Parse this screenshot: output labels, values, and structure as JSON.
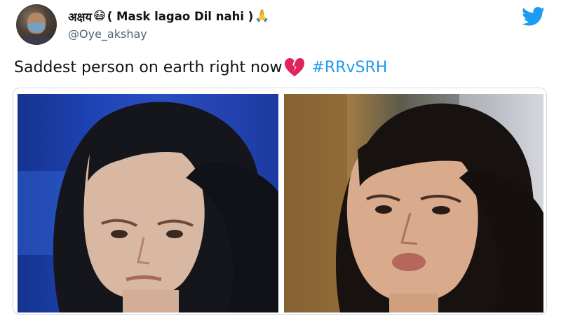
{
  "tweet": {
    "display_name_prefix": "अक्षय",
    "display_name_emoji_1": "😷",
    "display_name_main": "( Mask lagao Dil nahi )",
    "display_name_emoji_2": "🙏",
    "handle": "@Oye_akshay",
    "text": "Saddest person on earth right now",
    "text_emoji": "broken-heart",
    "hashtag": "#RRvSRH"
  },
  "icons": {
    "logo": "twitter-bird-icon",
    "avatar": "profile-avatar",
    "heart": "broken-heart-icon"
  },
  "colors": {
    "accent": "#1d9bf0",
    "handle": "#536471",
    "text": "#0f1419"
  }
}
